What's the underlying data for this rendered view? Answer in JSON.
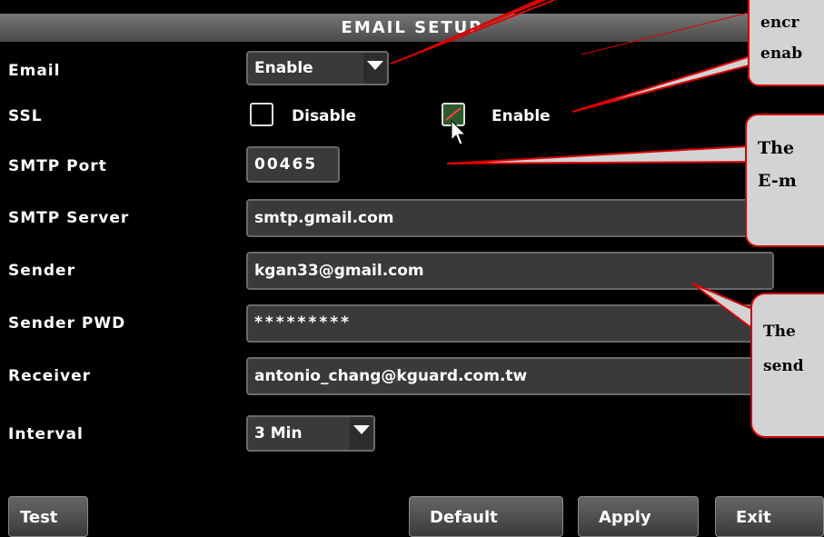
{
  "dialog": {
    "title": "EMAIL SETUP"
  },
  "fields": {
    "email": {
      "label": "Email",
      "value": "Enable"
    },
    "ssl": {
      "label": "SSL",
      "option_disable": "Disable",
      "option_enable": "Enable",
      "selected": "Enable"
    },
    "smtp_port": {
      "label": "SMTP Port",
      "value": "00465"
    },
    "smtp_server": {
      "label": "SMTP Server",
      "value": "smtp.gmail.com"
    },
    "sender": {
      "label": "Sender",
      "value": "kgan33@gmail.com"
    },
    "sender_pwd": {
      "label": "Sender PWD",
      "value": "*********"
    },
    "receiver": {
      "label": "Receiver",
      "value": "antonio_chang@kguard.com.tw"
    },
    "interval": {
      "label": "Interval",
      "value": "3 Min"
    }
  },
  "buttons": {
    "test": "Test",
    "default": "Default",
    "apply": "Apply",
    "exit": "Exit"
  },
  "callouts": {
    "top": {
      "line1": "encr",
      "line2": "enab"
    },
    "middle": {
      "line1": "The",
      "line2": "E-m"
    },
    "bottom": {
      "line1": "The",
      "line2": "send"
    }
  },
  "colors": {
    "callout_border": "#cc0000",
    "callout_fill": "#d3d3d3",
    "pointer_line": "#dd0000"
  }
}
